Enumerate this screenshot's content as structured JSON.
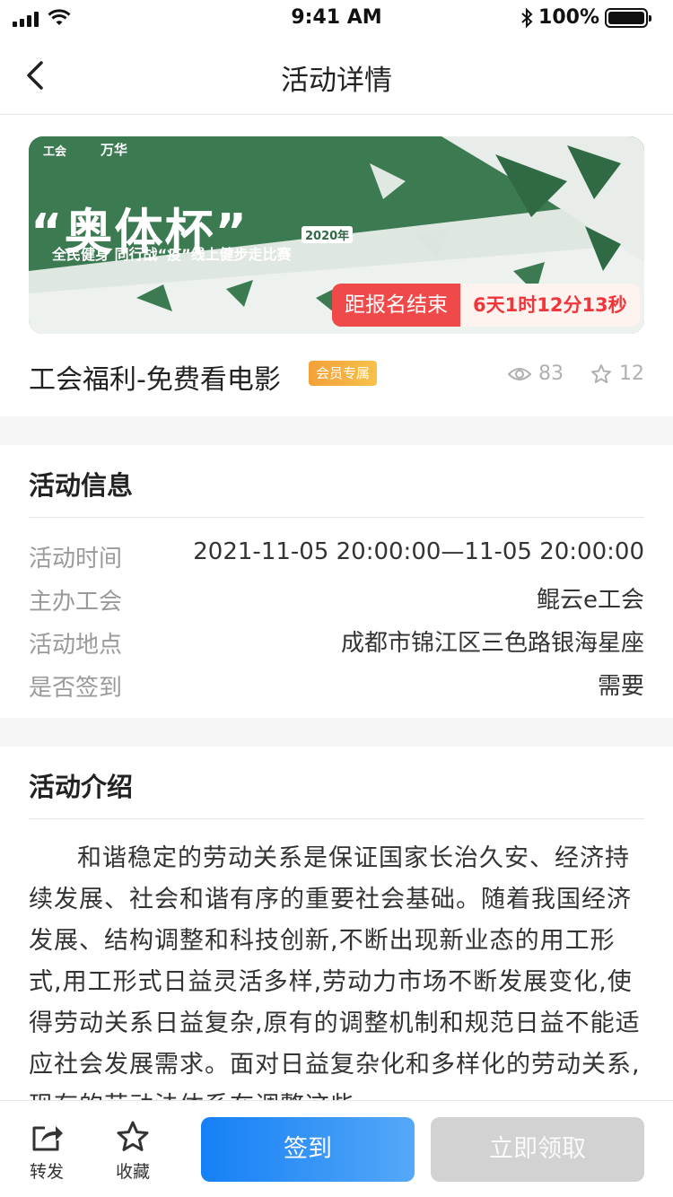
{
  "status_bar": {
    "time": "9:41 AM",
    "battery": "100%"
  },
  "nav": {
    "title": "活动详情"
  },
  "banner": {
    "logo_left": "工会",
    "logo_right": "万华",
    "headline": "“奥体杯”",
    "year_tag": "2020年",
    "subtitle": "全民健身 同行战“疫”线上健步走比赛",
    "countdown_label": "距报名结束",
    "countdown_time": "6天1时12分13秒"
  },
  "event": {
    "title": "工会福利-免费看电影",
    "badge": "会员专属",
    "views": "83",
    "favorites": "12"
  },
  "info": {
    "heading": "活动信息",
    "rows": [
      {
        "label": "活动时间",
        "value": "2021-11-05 20:00:00—11-05 20:00:00"
      },
      {
        "label": "主办工会",
        "value": "鲲云e工会"
      },
      {
        "label": "活动地点",
        "value": "成都市锦江区三色路银海星座"
      },
      {
        "label": "是否签到",
        "value": "需要"
      }
    ]
  },
  "intro": {
    "heading": "活动介绍",
    "text": "和谐稳定的劳动关系是保证国家长治久安、经济持续发展、社会和谐有序的重要社会基础。随着我国经济发展、结构调整和科技创新,不断出现新业态的用工形式,用工形式日益灵活多样,劳动力市场不断发展变化,使得劳动关系日益复杂,原有的调整机制和规范日益不能适应社会发展需求。面对日益复杂化和多样化的劳动关系,现有的劳动法体系在调整这些"
  },
  "bottom": {
    "share_label": "转发",
    "collect_label": "收藏",
    "checkin_label": "签到",
    "claim_label": "立即领取"
  },
  "colors": {
    "primary_blue": "#1580f6",
    "countdown_red": "#f0494a",
    "badge_orange": "#f5a03a",
    "banner_green": "#3c7a52"
  }
}
